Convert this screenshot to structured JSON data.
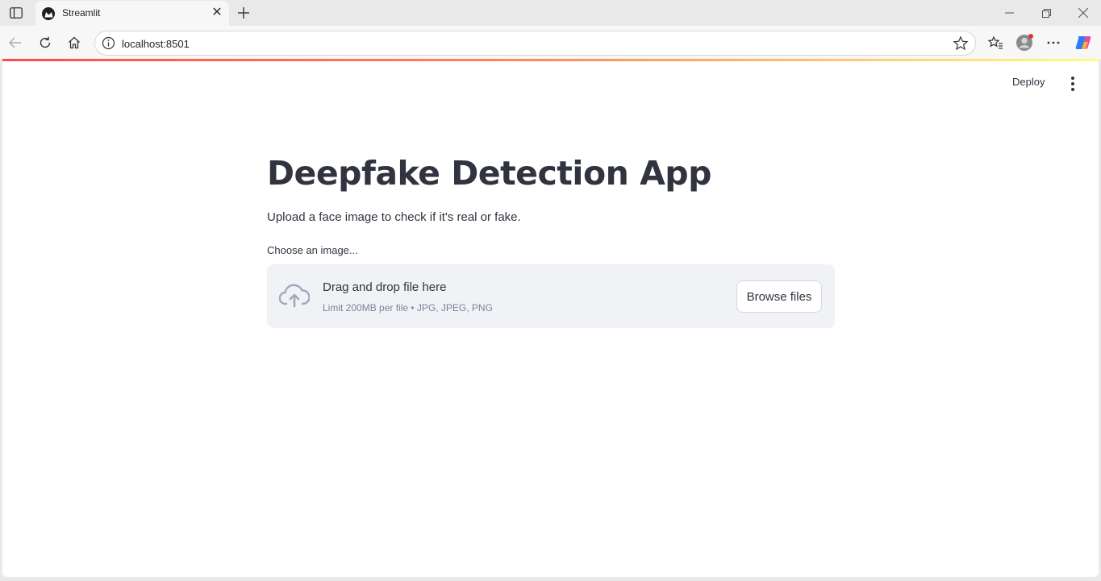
{
  "browser": {
    "tab": {
      "title": "Streamlit"
    },
    "address_bar": {
      "url": "localhost:8501"
    }
  },
  "app": {
    "header": {
      "deploy_label": "Deploy"
    },
    "title": "Deepfake Detection App",
    "subtitle": "Upload a face image to check if it's real or fake.",
    "uploader": {
      "label": "Choose an image...",
      "dropzone_title": "Drag and drop file here",
      "limit_text": "Limit 200MB per file • JPG, JPEG, PNG",
      "browse_label": "Browse files"
    }
  },
  "colors": {
    "text_primary": "#31333f",
    "dropzone_bg": "#f0f2f6",
    "accent_gradient_start": "#ff4b4b",
    "accent_gradient_end": "#fffd80"
  }
}
